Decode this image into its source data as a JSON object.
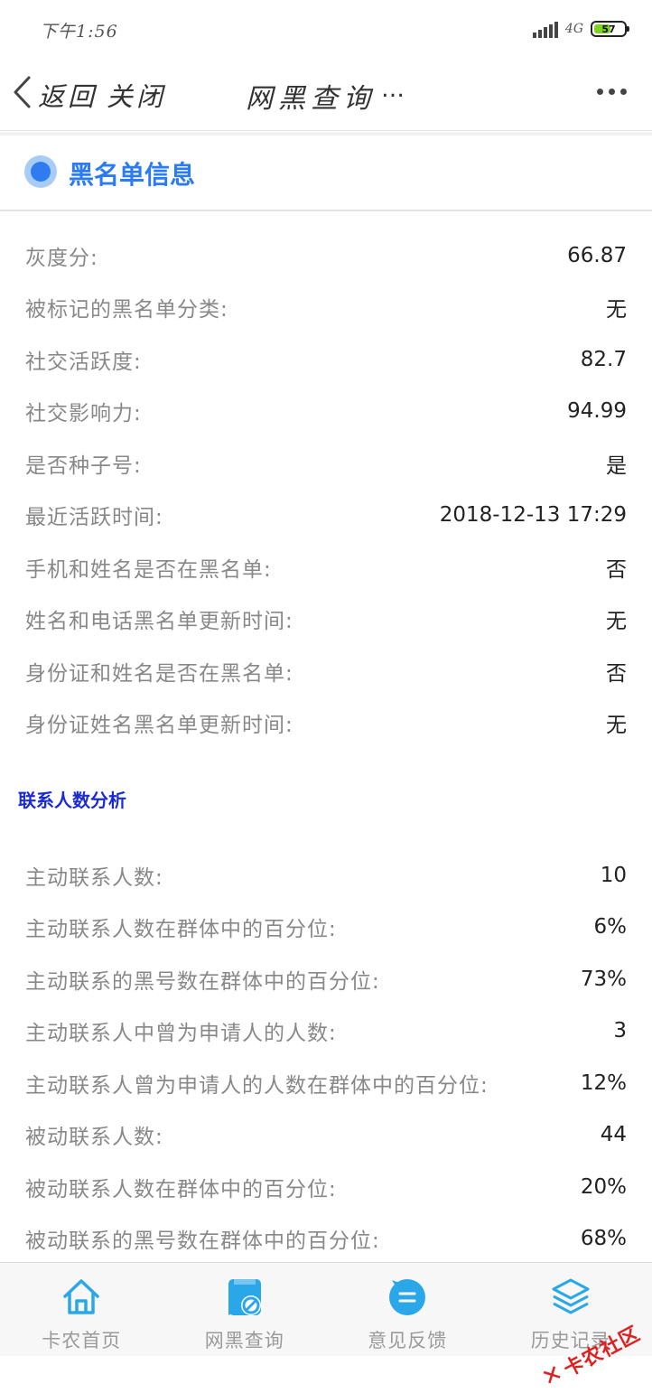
{
  "status_bar": {
    "time": "下午1:56",
    "network": "4G",
    "battery": "57",
    "battery_fraction": 0.57
  },
  "nav": {
    "back_label": "返回",
    "close_label": "关闭",
    "title": "网黑查询",
    "title_more": "…"
  },
  "blacklist_section": {
    "title": "黑名单信息",
    "rows": [
      {
        "label": "灰度分:",
        "value": "66.87"
      },
      {
        "label": "被标记的黑名单分类:",
        "value": "无"
      },
      {
        "label": "社交活跃度:",
        "value": "82.7"
      },
      {
        "label": "社交影响力:",
        "value": "94.99"
      },
      {
        "label": "是否种子号:",
        "value": "是"
      },
      {
        "label": "最近活跃时间:",
        "value": "2018-12-13 17:29"
      },
      {
        "label": "手机和姓名是否在黑名单:",
        "value": "否"
      },
      {
        "label": "姓名和电话黑名单更新时间:",
        "value": "无"
      },
      {
        "label": "身份证和姓名是否在黑名单:",
        "value": "否"
      },
      {
        "label": "身份证姓名黑名单更新时间:",
        "value": "无"
      }
    ]
  },
  "contacts_section": {
    "title": "联系人数分析",
    "rows": [
      {
        "label": "主动联系人数:",
        "value": "10"
      },
      {
        "label": "主动联系人数在群体中的百分位:",
        "value": "6%"
      },
      {
        "label": "主动联系的黑号数在群体中的百分位:",
        "value": "73%"
      },
      {
        "label": "主动联系人中曾为申请人的人数:",
        "value": "3"
      },
      {
        "label": "主动联系人曾为申请人的人数在群体中的百分位:",
        "value": "12%"
      },
      {
        "label": "被动联系人数:",
        "value": "44"
      },
      {
        "label": "被动联系人数在群体中的百分位:",
        "value": "20%"
      },
      {
        "label": "被动联系的黑号数在群体中的百分位:",
        "value": "68%"
      }
    ]
  },
  "tab_bar": {
    "items": [
      {
        "label": "卡农首页",
        "icon": "home-icon"
      },
      {
        "label": "网黑查询",
        "icon": "blacklist-query-icon"
      },
      {
        "label": "意见反馈",
        "icon": "feedback-icon"
      },
      {
        "label": "历史记录",
        "icon": "history-layers-icon"
      }
    ]
  },
  "watermark": {
    "text": "卡农社区"
  },
  "colors": {
    "accent_blue": "#2b7cf3",
    "subheading_blue": "#1a2bd6",
    "tab_icon_blue": "#2aa7e8",
    "watermark_red": "#e02020"
  }
}
